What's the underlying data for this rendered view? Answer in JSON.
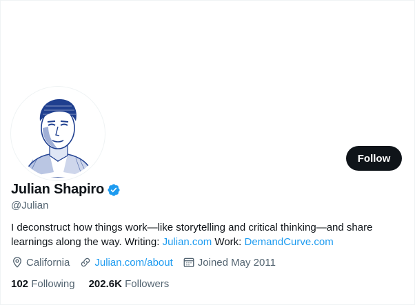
{
  "profile": {
    "display_name": "Julian Shapiro",
    "handle": "@Julian",
    "bio_text": "I deconstruct how things work—like storytelling and critical thinking—and share learnings along the way. Writing: ",
    "bio_link_1": "Julian.com",
    "bio_work_label": " Work: ",
    "bio_link_2": "DemandCurve.com",
    "location": "California",
    "website": "Julian.com/about",
    "joined": "Joined May 2011",
    "following_count": "102",
    "following_label": "Following",
    "followers_count": "202.6K",
    "followers_label": "Followers"
  },
  "actions": {
    "follow_label": "Follow"
  },
  "colors": {
    "accent": "#1d9bf0",
    "text": "#0f1419",
    "muted": "#536471",
    "button_bg": "#0f1419"
  },
  "icons": {
    "verified": "verified-badge-icon",
    "location": "location-pin-icon",
    "website": "link-icon",
    "joined": "calendar-icon"
  }
}
